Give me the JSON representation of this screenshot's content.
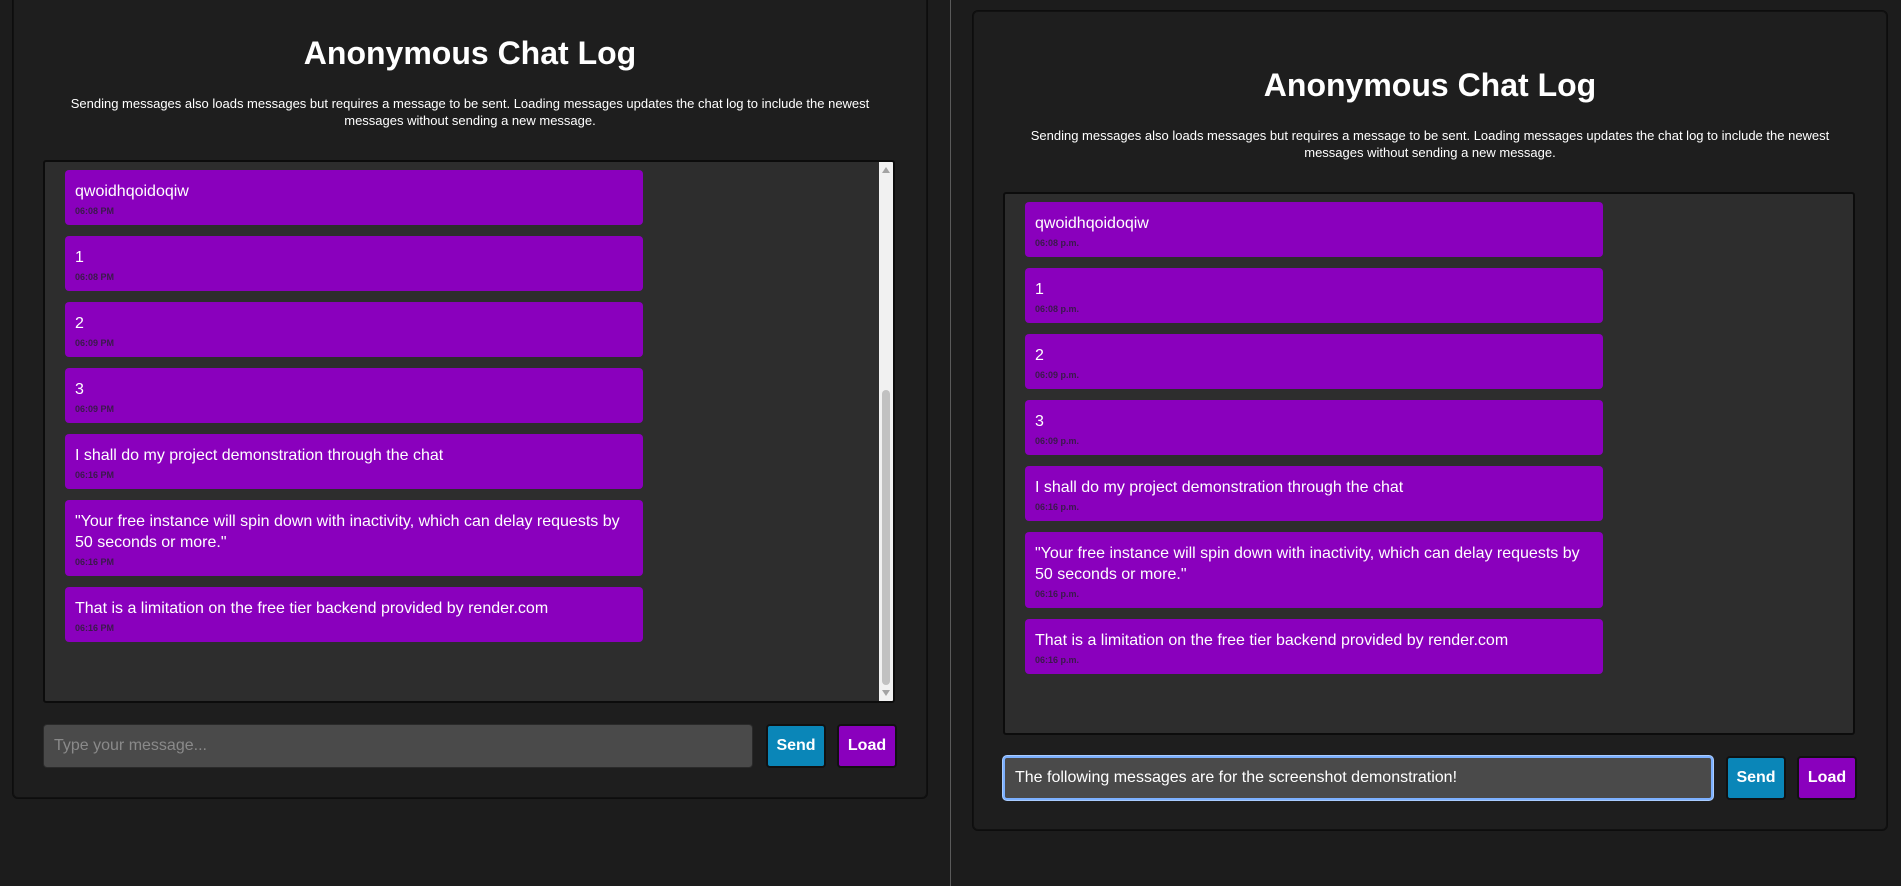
{
  "title": "Anonymous Chat Log",
  "description": "Sending messages also loads messages but requires a message to be sent. Loading messages updates the chat log to include the newest messages without sending a new message.",
  "placeholder": "Type your message...",
  "send_label": "Send",
  "load_label": "Load",
  "colors": {
    "message_bubble": "#8a00bd",
    "send_button": "#0a86b8",
    "load_button": "#8a00bd",
    "background": "#1c1c1c"
  },
  "left": {
    "input_value": "",
    "messages": [
      {
        "text": "qwoidhqoidoqiw",
        "time": "06:08 PM"
      },
      {
        "text": "1",
        "time": "06:08 PM"
      },
      {
        "text": "2",
        "time": "06:09 PM"
      },
      {
        "text": "3",
        "time": "06:09 PM"
      },
      {
        "text": "I shall do my project demonstration through the chat",
        "time": "06:16 PM"
      },
      {
        "text": "\"Your free instance will spin down with inactivity, which can delay requests by 50 seconds or more.\"",
        "time": "06:16 PM"
      },
      {
        "text": "That is a limitation on the free tier backend provided by render.com",
        "time": "06:16 PM"
      }
    ]
  },
  "right": {
    "input_value": "The following messages are for the screenshot demonstration!",
    "messages": [
      {
        "text": "qwoidhqoidoqiw",
        "time": "06:08 p.m."
      },
      {
        "text": "1",
        "time": "06:08 p.m."
      },
      {
        "text": "2",
        "time": "06:09 p.m."
      },
      {
        "text": "3",
        "time": "06:09 p.m."
      },
      {
        "text": "I shall do my project demonstration through the chat",
        "time": "06:16 p.m."
      },
      {
        "text": "\"Your free instance will spin down with inactivity, which can delay requests by 50 seconds or more.\"",
        "time": "06:16 p.m."
      },
      {
        "text": "That is a limitation on the free tier backend provided by render.com",
        "time": "06:16 p.m."
      }
    ]
  }
}
